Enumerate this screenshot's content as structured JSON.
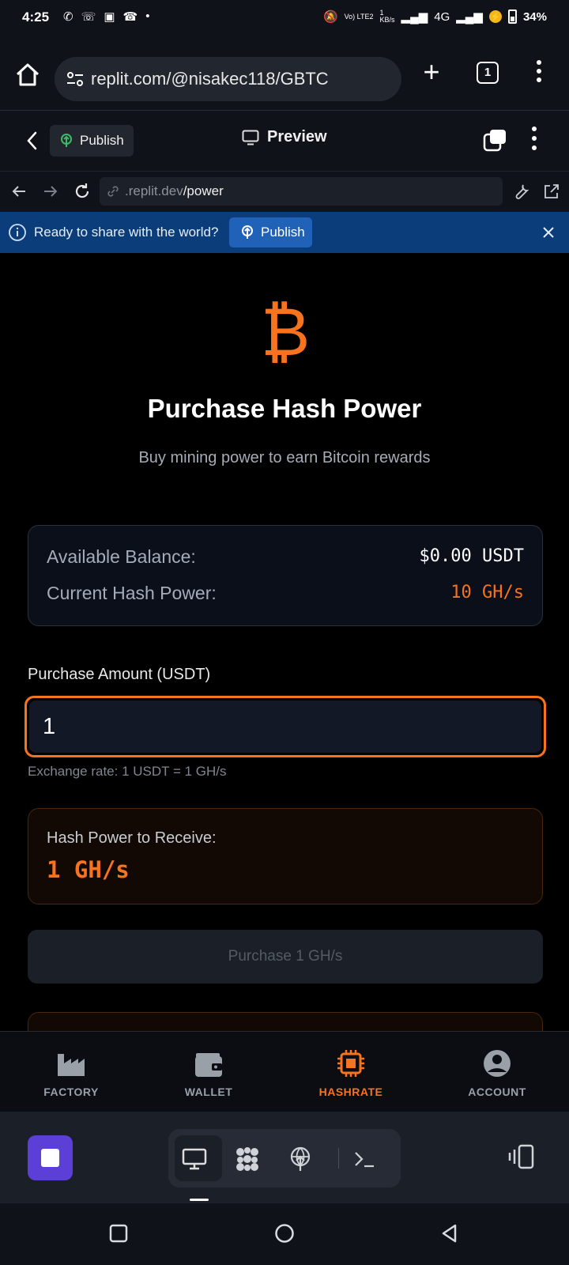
{
  "status_bar": {
    "time": "4:25",
    "net_speed_top": "1",
    "net_speed_unit": "KB/s",
    "volte": "Vo) LTE2",
    "network": "4G",
    "battery": "34%"
  },
  "browser": {
    "url": "replit.com/@nisakec118/GBTC",
    "tab_count": "1"
  },
  "replit_bar": {
    "publish_label": "Publish",
    "preview_label": "Preview"
  },
  "webview": {
    "url_domain": ".replit.dev",
    "url_path": "/power"
  },
  "banner": {
    "message": "Ready to share with the world?",
    "button_label": "Publish"
  },
  "page": {
    "logo_glyph": "₿",
    "title": "Purchase Hash Power",
    "subtitle": "Buy mining power to earn Bitcoin rewards",
    "balance_label": "Available Balance:",
    "balance_value": "$0.00 USDT",
    "hash_label": "Current Hash Power:",
    "hash_value": "10 GH/s",
    "amount_label": "Purchase Amount (USDT)",
    "amount_value": "1",
    "exchange_rate": "Exchange rate: 1 USDT = 1 GH/s",
    "receive_label": "Hash Power to Receive:",
    "receive_value": "1 GH/s",
    "purchase_button": "Purchase 1 GH/s"
  },
  "app_nav": {
    "items": [
      {
        "label": "FACTORY",
        "icon": "factory-icon"
      },
      {
        "label": "WALLET",
        "icon": "wallet-icon"
      },
      {
        "label": "HASHRATE",
        "icon": "chip-icon"
      },
      {
        "label": "ACCOUNT",
        "icon": "account-icon"
      }
    ],
    "active": "HASHRATE"
  },
  "colors": {
    "accent": "#f7731d",
    "banner": "#0b3d7a",
    "stop_button": "#5b3fd6"
  }
}
